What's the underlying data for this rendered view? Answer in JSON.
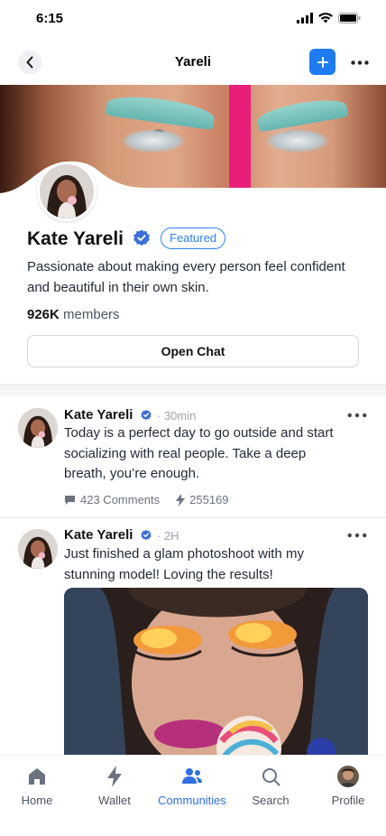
{
  "status_bar": {
    "time": "6:15"
  },
  "header": {
    "title": "Yareli"
  },
  "profile": {
    "name": "Kate Yareli",
    "badge": "Featured",
    "bio": "Passionate about making every person feel confident and beautiful in their own skin.",
    "members_count": "926K",
    "members_label": "members",
    "open_chat_label": "Open Chat"
  },
  "posts": [
    {
      "author": "Kate Yareli",
      "time": "30min",
      "text": "Today is a perfect day to go outside and start socializing with real people. Take a deep breath, you’re enough.",
      "comments": "423 Comments",
      "reactions": "255169"
    },
    {
      "author": "Kate Yareli",
      "time": "2H",
      "text": "Just finished a glam photoshoot with my stunning model! Loving the results!"
    }
  ],
  "bottom_nav": {
    "items": [
      {
        "label": "Home",
        "icon": "home-icon"
      },
      {
        "label": "Wallet",
        "icon": "bolt-icon"
      },
      {
        "label": "Communities",
        "icon": "people-icon",
        "active": true
      },
      {
        "label": "Search",
        "icon": "search-icon"
      },
      {
        "label": "Profile",
        "icon": "avatar"
      }
    ]
  },
  "colors": {
    "accent": "#2f6fe0",
    "plus_button": "#1e7bf2",
    "verified": "#3b6fd8"
  }
}
